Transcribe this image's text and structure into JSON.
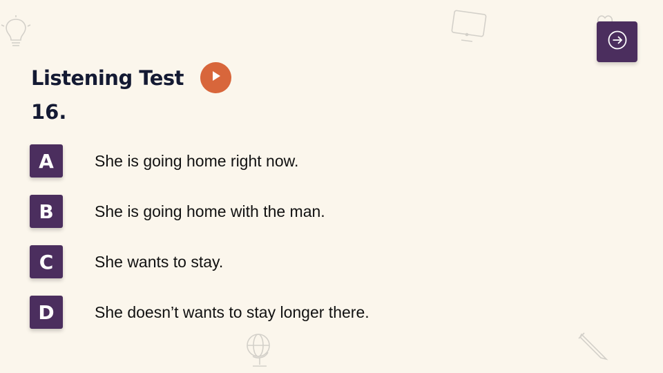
{
  "header": {
    "title": "Listening Test"
  },
  "question": {
    "number": "16.",
    "options": [
      {
        "letter": "A",
        "text": "She is going home right now."
      },
      {
        "letter": "B",
        "text": "She is going home with the man."
      },
      {
        "letter": "C",
        "text": "She wants to stay."
      },
      {
        "letter": "D",
        "text": "She doesn’t wants to stay longer there."
      }
    ]
  },
  "icons": {
    "next": "arrow-right-circle-icon",
    "play": "play-icon",
    "decorations": [
      "lightbulb-icon",
      "monitor-icon",
      "heart-icon",
      "globe-icon",
      "pencil-icon"
    ]
  },
  "colors": {
    "background": "#fbf6ec",
    "accent_purple": "#4b2e5e",
    "play_orange": "#d8663b",
    "title_navy": "#141a33"
  }
}
